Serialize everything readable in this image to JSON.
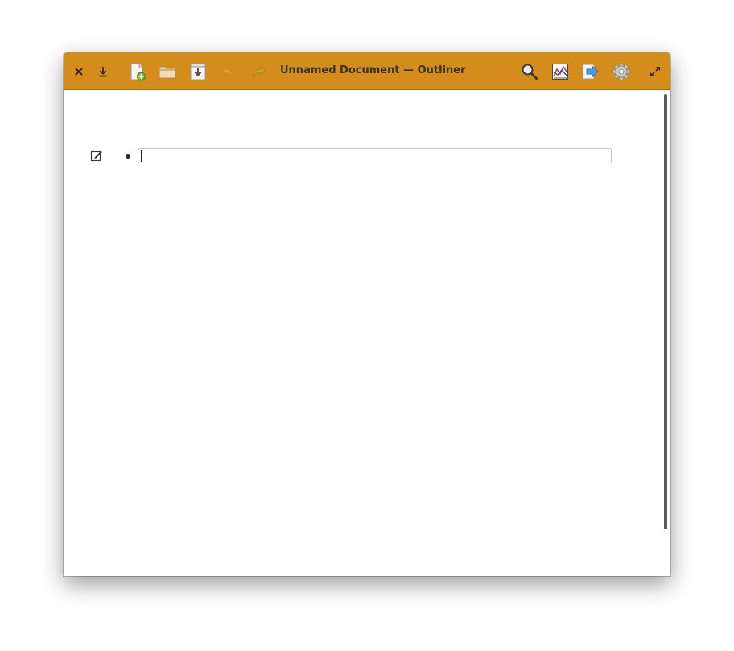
{
  "window": {
    "title": "Unnamed Document — Outliner"
  },
  "headerbar": {
    "background": "#d48c1a",
    "left_buttons": [
      {
        "name": "close-button",
        "icon": "close-icon"
      },
      {
        "name": "save-button",
        "icon": "download-arrow-icon"
      },
      {
        "name": "new-document-button",
        "icon": "new-document-icon"
      },
      {
        "name": "open-folder-button",
        "icon": "folder-icon"
      },
      {
        "name": "import-button",
        "icon": "import-document-icon"
      },
      {
        "name": "undo-button",
        "icon": "undo-icon"
      },
      {
        "name": "redo-button",
        "icon": "redo-icon"
      }
    ],
    "right_buttons": [
      {
        "name": "search-button",
        "icon": "search-icon"
      },
      {
        "name": "statistics-button",
        "icon": "chart-icon"
      },
      {
        "name": "export-button",
        "icon": "export-arrow-icon"
      },
      {
        "name": "settings-button",
        "icon": "gear-icon"
      },
      {
        "name": "fullscreen-button",
        "icon": "fullscreen-icon"
      }
    ]
  },
  "outline": {
    "items": [
      {
        "text": "",
        "bullet": "•"
      }
    ]
  }
}
